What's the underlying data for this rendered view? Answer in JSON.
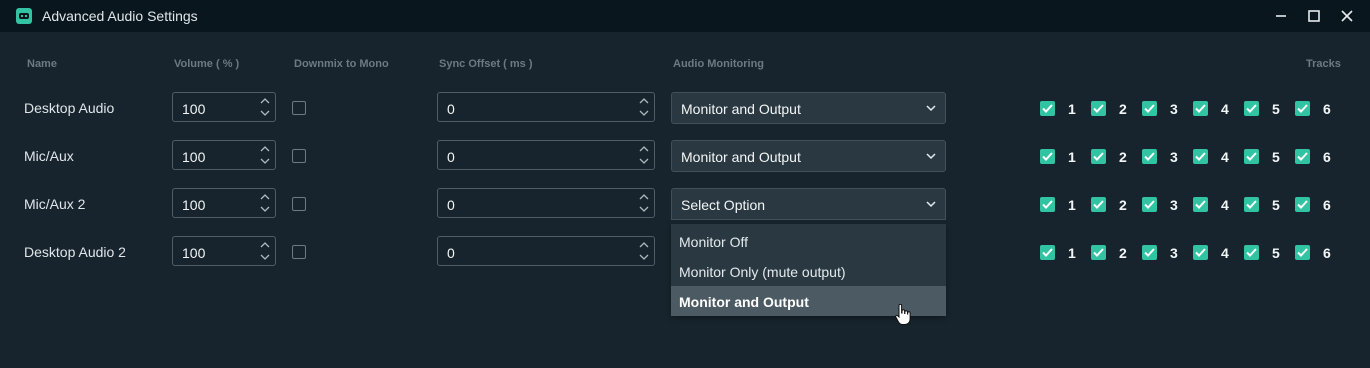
{
  "window": {
    "title": "Advanced Audio Settings",
    "app_icon": "streamlabs-icon"
  },
  "headers": {
    "name": "Name",
    "volume": "Volume ( % )",
    "downmix": "Downmix to Mono",
    "sync": "Sync Offset ( ms )",
    "monitoring": "Audio Monitoring",
    "tracks": "Tracks"
  },
  "rows": [
    {
      "name": "Desktop Audio",
      "volume": "100",
      "downmix": false,
      "sync": "0",
      "monitoring": "Monitor and Output",
      "tracks": [
        "1",
        "2",
        "3",
        "4",
        "5",
        "6"
      ]
    },
    {
      "name": "Mic/Aux",
      "volume": "100",
      "downmix": false,
      "sync": "0",
      "monitoring": "Monitor and Output",
      "tracks": [
        "1",
        "2",
        "3",
        "4",
        "5",
        "6"
      ]
    },
    {
      "name": "Mic/Aux 2",
      "volume": "100",
      "downmix": false,
      "sync": "0",
      "monitoring": "Select Option",
      "tracks": [
        "1",
        "2",
        "3",
        "4",
        "5",
        "6"
      ]
    },
    {
      "name": "Desktop Audio 2",
      "volume": "100",
      "downmix": false,
      "sync": "0",
      "monitoring": "",
      "tracks": [
        "1",
        "2",
        "3",
        "4",
        "5",
        "6"
      ]
    }
  ],
  "dropdown": {
    "options": [
      "Monitor Off",
      "Monitor Only (mute output)",
      "Monitor and Output"
    ],
    "highlighted_index": 2
  },
  "colors": {
    "accent": "#31c3a2",
    "background": "#17242d",
    "titlebar": "#09161d"
  }
}
